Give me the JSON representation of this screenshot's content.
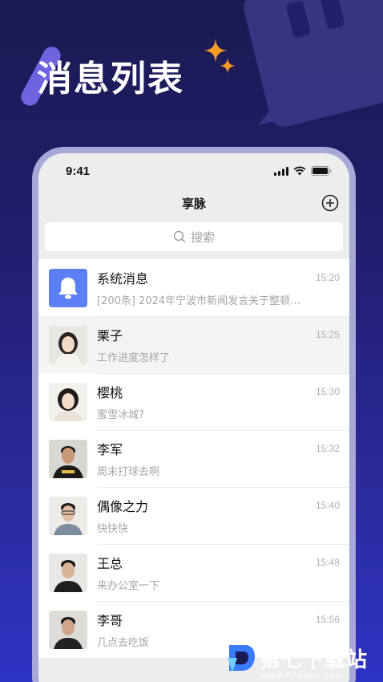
{
  "hero": {
    "title": "消息列表"
  },
  "status_bar": {
    "time": "9:41"
  },
  "nav": {
    "title": "享脉",
    "add_icon": "plus-circle-icon"
  },
  "search": {
    "placeholder": "搜索",
    "icon": "search-icon"
  },
  "messages": [
    {
      "name": "系统消息",
      "time": "15:20",
      "preview": "[200条] 2024年宁波市新闻发言关于整顿…",
      "avatar": "bell-icon"
    },
    {
      "name": "栗子",
      "time": "15:25",
      "preview": "工作进度怎样了"
    },
    {
      "name": "樱桃",
      "time": "15:30",
      "preview": "蜜雪冰城?"
    },
    {
      "name": "李军",
      "time": "15:32",
      "preview": "周末打球去啊"
    },
    {
      "name": "偶像之力",
      "time": "15:40",
      "preview": "快快快"
    },
    {
      "name": "王总",
      "time": "15:48",
      "preview": "来办公室一下"
    },
    {
      "name": "李哥",
      "time": "15:56",
      "preview": "几点去吃饭"
    }
  ],
  "watermark": {
    "text": "第七下载站",
    "url": "www.d7down.com"
  },
  "colors": {
    "accent": "#5b7ff4",
    "background": "#221d6e",
    "sparkle": "#f59a23"
  }
}
